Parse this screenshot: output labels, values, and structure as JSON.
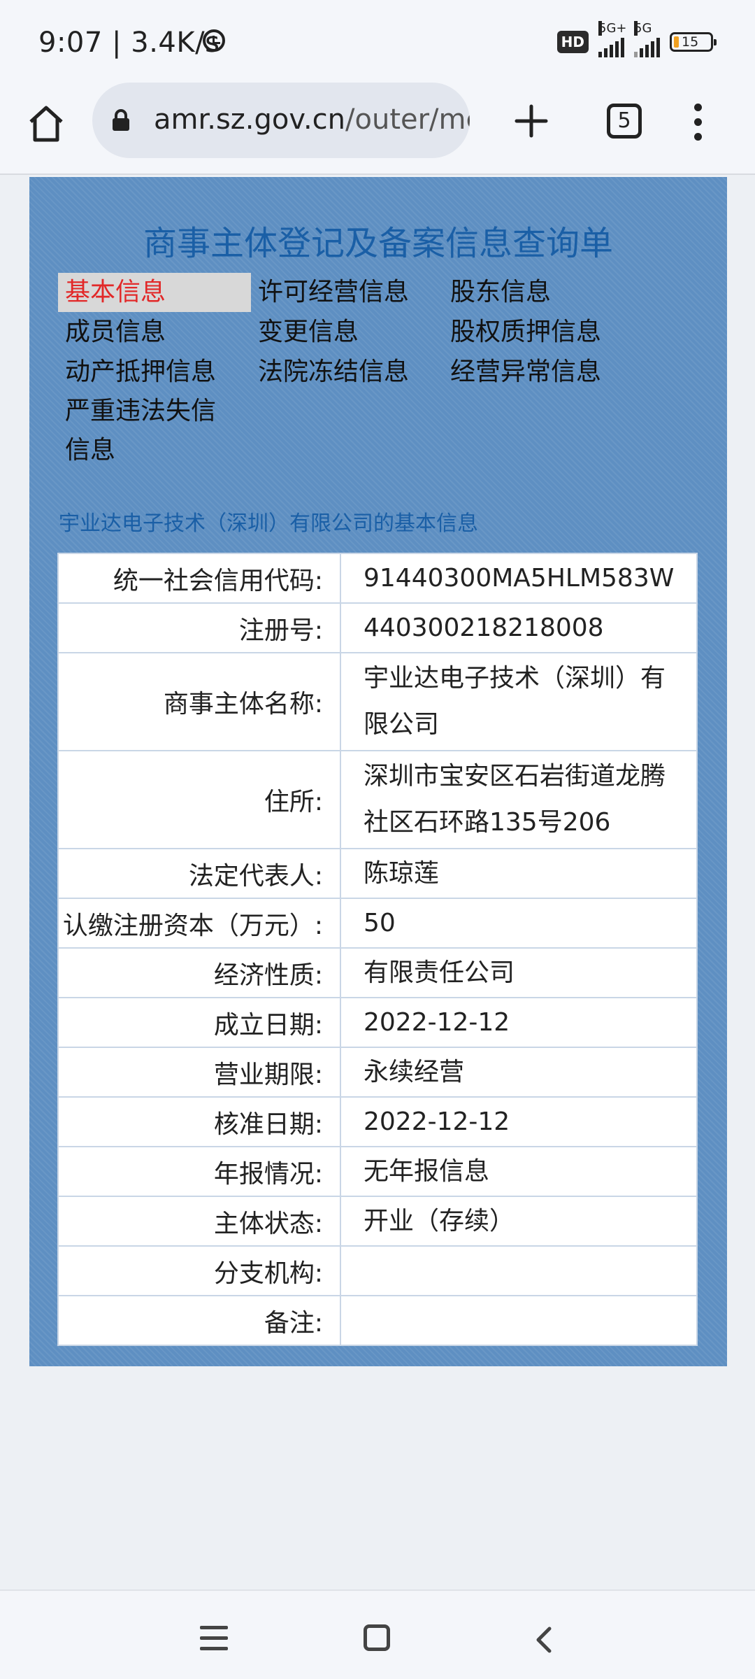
{
  "status_bar": {
    "time": "9:07",
    "net_speed": "3.4K/s",
    "hd_badge": "HD",
    "signal1_label": "5G+",
    "signal2_label": "5G",
    "battery": "15"
  },
  "browser": {
    "url_domain": "amr.sz.gov.cn",
    "url_path": "/outer/mc",
    "tab_count": "5"
  },
  "page": {
    "title": "商事主体登记及备案信息查询单",
    "nav": [
      {
        "label": "基本信息"
      },
      {
        "label": "许可经营信息"
      },
      {
        "label": "股东信息"
      },
      {
        "label": "成员信息"
      },
      {
        "label": "变更信息"
      },
      {
        "label": "股权质押信息"
      },
      {
        "label": "动产抵押信息"
      },
      {
        "label": "法院冻结信息"
      },
      {
        "label": "经营异常信息"
      },
      {
        "label": "严重违法失信"
      },
      {
        "label": "信息"
      }
    ],
    "section_title": "宇业达电子技术（深圳）有限公司的基本信息",
    "rows": [
      {
        "label": "统一社会信用代码:",
        "value": "91440300MA5HLM583W"
      },
      {
        "label": "注册号:",
        "value": "440300218218008"
      },
      {
        "label": "商事主体名称:",
        "value": "宇业达电子技术（深圳）有限公司"
      },
      {
        "label": "住所:",
        "value": "深圳市宝安区石岩街道龙腾社区石环路135号206"
      },
      {
        "label": "法定代表人:",
        "value": "陈琼莲"
      },
      {
        "label": "认缴注册资本（万元）:",
        "value": "50"
      },
      {
        "label": "经济性质:",
        "value": "有限责任公司"
      },
      {
        "label": "成立日期:",
        "value": "2022-12-12"
      },
      {
        "label": "营业期限:",
        "value": "永续经营"
      },
      {
        "label": "核准日期:",
        "value": "2022-12-12"
      },
      {
        "label": "年报情况:",
        "value": "无年报信息"
      },
      {
        "label": "主体状态:",
        "value": "开业（存续）"
      },
      {
        "label": "分支机构:",
        "value": ""
      },
      {
        "label": "备注:",
        "value": ""
      }
    ]
  },
  "icons": {
    "home": "home-icon",
    "lock": "lock-icon",
    "new_tab": "plus-icon",
    "tabs": "tabs-icon",
    "menu": "more-vert-icon",
    "alarm": "alarm-icon",
    "nav_menu": "recents-icon",
    "nav_home": "square-home-icon",
    "nav_back": "back-icon"
  },
  "colors": {
    "panel_bg": "#5e8fc2",
    "title_blue": "#1a5fa6",
    "active_red": "#e22828"
  }
}
